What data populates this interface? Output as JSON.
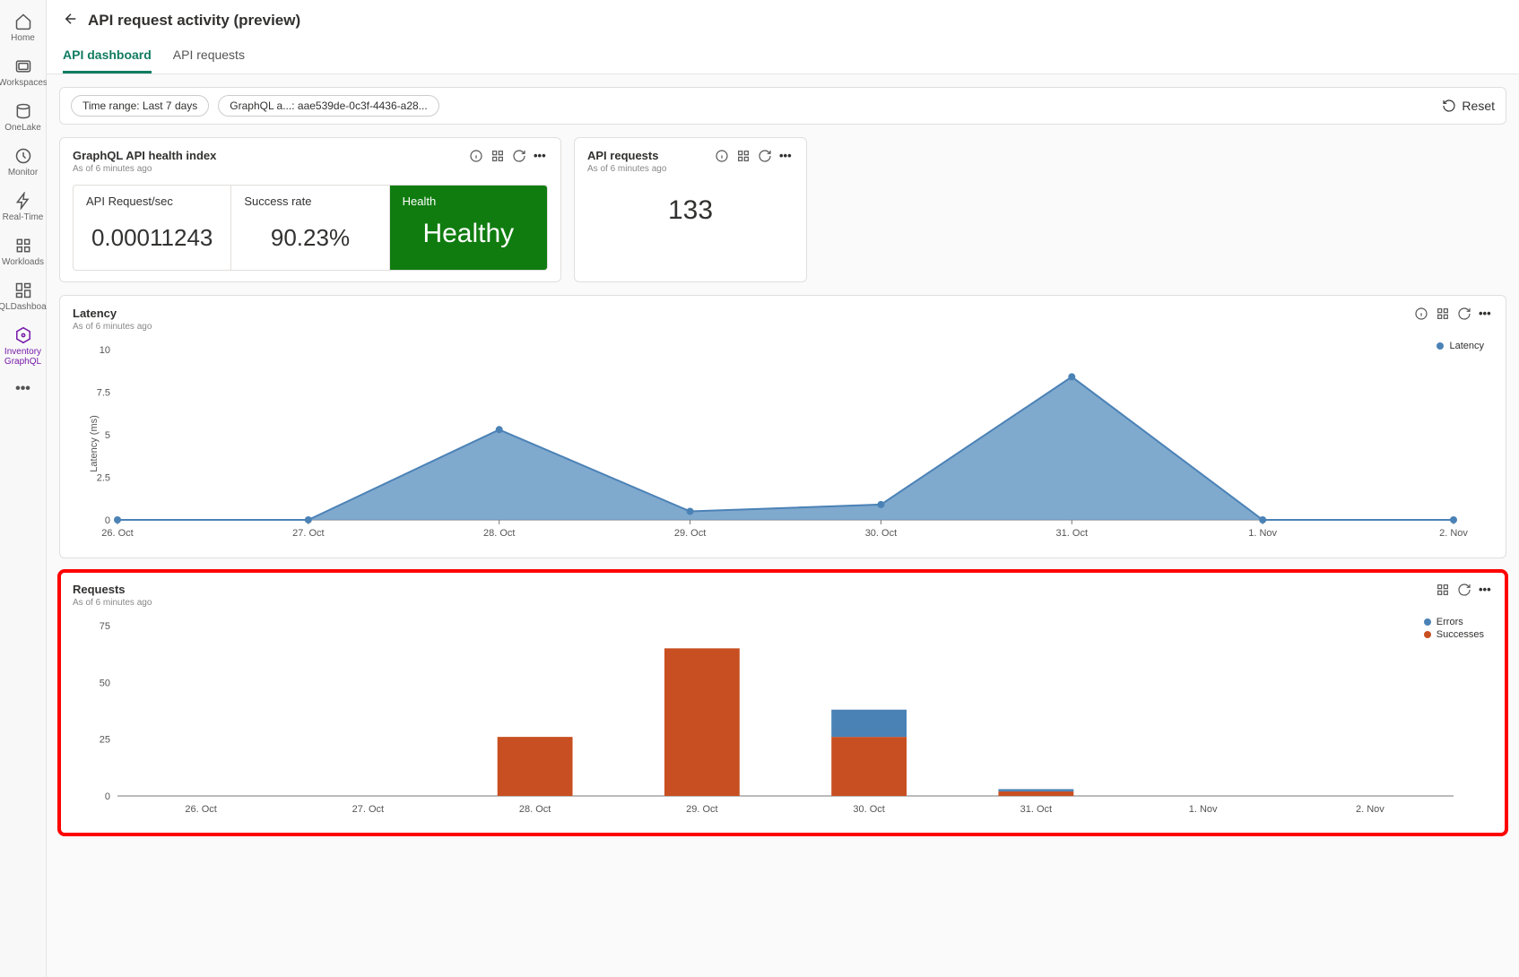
{
  "sidebar": {
    "items": [
      {
        "label": "Home",
        "icon": "home"
      },
      {
        "label": "Workspaces",
        "icon": "workspaces"
      },
      {
        "label": "OneLake",
        "icon": "onelake"
      },
      {
        "label": "Monitor",
        "icon": "monitor"
      },
      {
        "label": "Real-Time",
        "icon": "realtime"
      },
      {
        "label": "Workloads",
        "icon": "workloads"
      },
      {
        "label": "GQLDashboard",
        "icon": "dashboard"
      },
      {
        "label": "Inventory GraphQL",
        "icon": "graphql"
      }
    ]
  },
  "header": {
    "title": "API request activity (preview)",
    "tabs": [
      {
        "label": "API dashboard",
        "active": true
      },
      {
        "label": "API requests",
        "active": false
      }
    ]
  },
  "filters": {
    "time_range": "Time range: Last 7 days",
    "graphql": "GraphQL a...: aae539de-0c3f-4436-a28...",
    "reset": "Reset"
  },
  "cards": {
    "health": {
      "title": "GraphQL API health index",
      "sub": "As of 6 minutes ago",
      "metrics": {
        "rps_label": "API Request/sec",
        "rps_value": "0.00011243",
        "success_label": "Success rate",
        "success_value": "90.23%",
        "health_label": "Health",
        "health_value": "Healthy"
      }
    },
    "requests": {
      "title": "API requests",
      "sub": "As of 6 minutes ago",
      "value": "133"
    },
    "latency": {
      "title": "Latency",
      "sub": "As of 6 minutes ago",
      "legend": "Latency",
      "ylabel": "Latency (ms)"
    },
    "requests_chart": {
      "title": "Requests",
      "sub": "As of 6 minutes ago",
      "legend_errors": "Errors",
      "legend_success": "Successes"
    }
  },
  "chart_data": [
    {
      "type": "area",
      "title": "Latency",
      "ylabel": "Latency (ms)",
      "ylim": [
        0,
        10
      ],
      "yticks": [
        0,
        2.5,
        5,
        7.5,
        10
      ],
      "categories": [
        "26. Oct",
        "27. Oct",
        "28. Oct",
        "29. Oct",
        "30. Oct",
        "31. Oct",
        "1. Nov",
        "2. Nov"
      ],
      "series": [
        {
          "name": "Latency",
          "values": [
            0,
            0,
            5.3,
            0.5,
            0.9,
            8.4,
            0,
            0
          ]
        }
      ]
    },
    {
      "type": "bar",
      "title": "Requests",
      "ylim": [
        0,
        75
      ],
      "yticks": [
        0,
        25,
        50,
        75
      ],
      "categories": [
        "26. Oct",
        "27. Oct",
        "28. Oct",
        "29. Oct",
        "30. Oct",
        "31. Oct",
        "1. Nov",
        "2. Nov"
      ],
      "series": [
        {
          "name": "Successes",
          "values": [
            0,
            0,
            26,
            65,
            26,
            2,
            0,
            0
          ],
          "color": "#c84f21"
        },
        {
          "name": "Errors",
          "values": [
            0,
            0,
            0,
            0,
            12,
            1,
            0,
            0
          ],
          "color": "#4b82b6"
        }
      ]
    }
  ]
}
